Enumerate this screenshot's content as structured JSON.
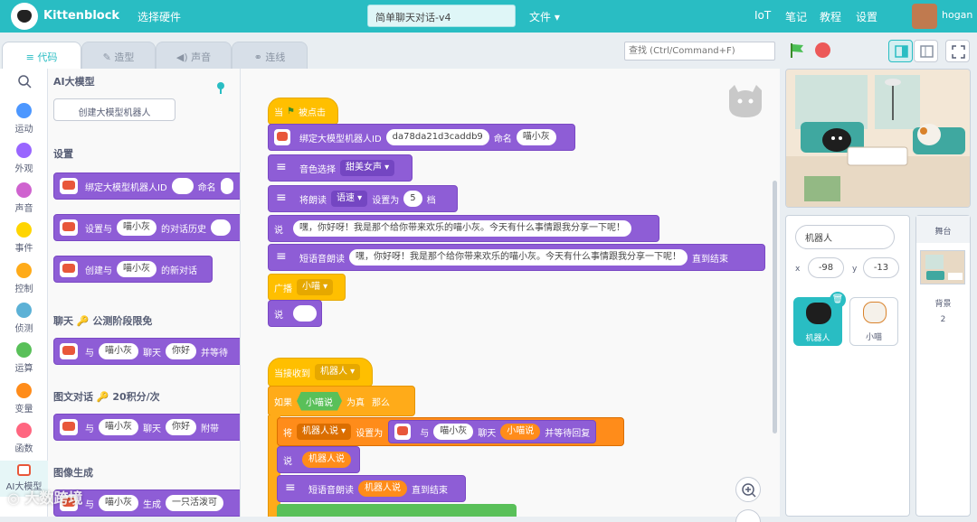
{
  "app": {
    "name": "Kittenblock",
    "hardware": "选择硬件",
    "project_name": "简单聊天对话-v4",
    "file_menu": "文件",
    "nav": [
      "IoT",
      "笔记",
      "教程",
      "设置"
    ],
    "user": "hogan"
  },
  "tabs": [
    "代码",
    "造型",
    "声音",
    "连线"
  ],
  "search": {
    "placeholder": "查找 (Ctrl/Command+F)"
  },
  "categories": [
    {
      "label": "运动",
      "color": "#4c97ff"
    },
    {
      "label": "外观",
      "color": "#9966ff"
    },
    {
      "label": "声音",
      "color": "#cf63cf"
    },
    {
      "label": "事件",
      "color": "#ffd500"
    },
    {
      "label": "控制",
      "color": "#ffab19"
    },
    {
      "label": "侦测",
      "color": "#5cb1d6"
    },
    {
      "label": "运算",
      "color": "#59c059"
    },
    {
      "label": "变量",
      "color": "#ff8c1a"
    },
    {
      "label": "函数",
      "color": "#ff6680"
    },
    {
      "label": "AI大模型",
      "color": "#e8573a"
    }
  ],
  "palette": {
    "title": "AI大模型",
    "create_button": "创建大模型机器人",
    "section_setup": "设置",
    "b1": {
      "t1": "绑定大模型机器人ID",
      "t2": "命名"
    },
    "b2": {
      "t1": "设置与",
      "v": "喵小灰",
      "t2": "的对话历史"
    },
    "b3": {
      "t1": "创建与",
      "v": "喵小灰",
      "t2": "的新对话"
    },
    "section_chat": "聊天 🔑 公测阶段限免",
    "b4": {
      "t1": "与",
      "v": "喵小灰",
      "t2": "聊天",
      "v2": "你好",
      "t3": "并等待"
    },
    "section_img": "图文对话 🔑 20积分/次",
    "b5": {
      "t1": "与",
      "v": "喵小灰",
      "t2": "聊天",
      "v2": "你好",
      "t3": "附带"
    },
    "section_gen": "图像生成",
    "b6": {
      "t1": "与",
      "v": "喵小灰",
      "t2": "生成",
      "v2": "一只活泼可"
    }
  },
  "script": {
    "when_flag": "当",
    "clicked": "被点击",
    "bind": {
      "t1": "绑定大模型机器人ID",
      "id": "da78da21d3caddb9",
      "t2": "命名",
      "name": "喵小灰"
    },
    "voice": {
      "t1": "音色选择",
      "v": "甜美女声"
    },
    "speed": {
      "t1": "将朗读",
      "v": "语速",
      "t2": "设置为",
      "n": "5",
      "t3": "档"
    },
    "say1": {
      "t1": "说",
      "text": "嘿，你好呀！我是那个给你带来欢乐的喵小灰。今天有什么事情跟我分享一下呢！"
    },
    "tts1": {
      "t1": "短语音朗读",
      "text": "嘿，你好呀！我是那个给你带来欢乐的喵小灰。今天有什么事情跟我分享一下呢！",
      "t2": "直到结束"
    },
    "broadcast": {
      "t1": "广播",
      "v": "小喵"
    },
    "say2": {
      "t1": "说"
    },
    "receive": {
      "t1": "当接收到",
      "v": "机器人"
    },
    "if": {
      "t1": "如果",
      "cond": "小喵说",
      "t2": "为真",
      "t3": "那么"
    },
    "set": {
      "t1": "将",
      "var": "机器人说",
      "t2": "设置为",
      "t3": "与",
      "bot": "喵小灰",
      "t4": "聊天",
      "msg": "小喵说",
      "t5": "并等待回复"
    },
    "say3": {
      "t1": "说",
      "v": "机器人说"
    },
    "tts2": {
      "t1": "短语音朗读",
      "v": "机器人说",
      "t2": "直到结束"
    }
  },
  "sprite_panel": {
    "sprite_name": "机器人",
    "x_label": "x",
    "x": "-98",
    "y_label": "y",
    "y": "-13",
    "sprites": [
      "机器人",
      "小喵"
    ]
  },
  "stage_panel": {
    "title": "舞台",
    "backdrop_label": "背景",
    "backdrop_count": "2"
  },
  "watermark": "大数跨境"
}
